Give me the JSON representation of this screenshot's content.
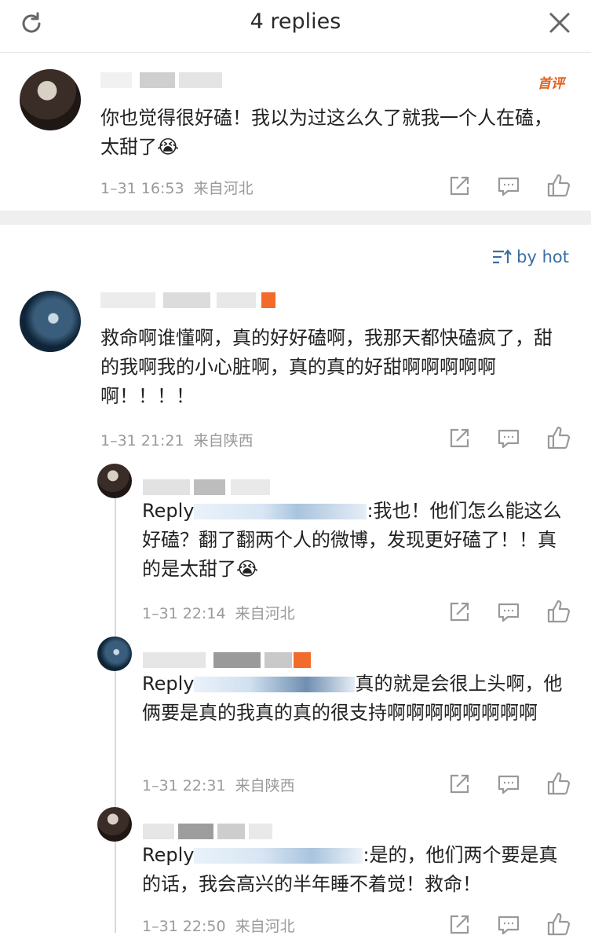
{
  "header": {
    "title": "4 replies",
    "refresh_icon": "refresh-icon",
    "close_icon": "close-icon"
  },
  "root_comment": {
    "badge": "首评",
    "text": "你也觉得很好磕！我以为过这么久了就我一个人在磕，太甜了😭",
    "time": "1–31 16:53",
    "location": "来自河北"
  },
  "sort": {
    "label": "by hot",
    "icon": "sort-icon"
  },
  "comments": [
    {
      "text": "救命啊谁懂啊，真的好好磕啊，我那天都快磕疯了，甜的我啊我的小心脏啊，真的真的好甜啊啊啊啊啊啊！！！！",
      "time": "1–31 21:21",
      "location": "来自陕西"
    },
    {
      "reply_prefix": "Reply",
      "text": ":我也！他们怎么能这么好磕？翻了翻两个人的微博，发现更好磕了！！真的是太甜了😭",
      "time": "1–31 22:14",
      "location": "来自河北"
    },
    {
      "reply_prefix": "Reply",
      "text": "真的就是会很上头啊，他俩要是真的我真的真的很支持啊啊啊啊啊啊啊啊",
      "time": "1–31 22:31",
      "location": "来自陕西"
    },
    {
      "reply_prefix": "Reply",
      "text": ":是的，他们两个要是真的话，我会高兴的半年睡不着觉！救命！",
      "time": "1–31 22:50",
      "location": "来自河北"
    }
  ],
  "action_icons": [
    "share-icon",
    "comment-icon",
    "like-icon"
  ],
  "colors": {
    "link": "#3a6ea5",
    "meta": "#9a9a9a",
    "badge": "#e2611d",
    "separator": "#efefef"
  }
}
